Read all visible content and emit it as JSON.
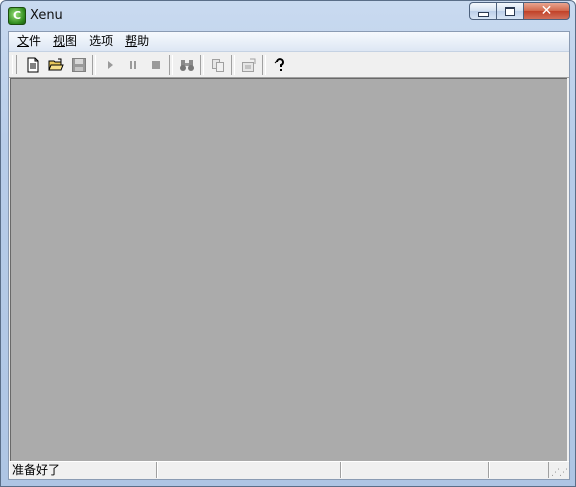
{
  "window": {
    "title": "Xenu",
    "icon": "xenu-frog-icon",
    "icon_letter": "C"
  },
  "menu": {
    "items": [
      {
        "label_ul": "文",
        "label_rest": "件"
      },
      {
        "label_ul": "视",
        "label_rest": "图"
      },
      {
        "label_ul": "",
        "label_rest": "选项"
      },
      {
        "label_ul": "帮",
        "label_rest": "助"
      }
    ]
  },
  "toolbar": {
    "buttons": [
      {
        "name": "new-icon",
        "enabled": true
      },
      {
        "name": "open-icon",
        "enabled": true
      },
      {
        "name": "save-icon",
        "enabled": false
      },
      {
        "name": "play-icon",
        "enabled": false
      },
      {
        "name": "pause-icon",
        "enabled": false
      },
      {
        "name": "stop-icon",
        "enabled": false
      },
      {
        "name": "binoculars-icon",
        "enabled": false
      },
      {
        "name": "copy-icon",
        "enabled": false
      },
      {
        "name": "properties-icon",
        "enabled": false
      },
      {
        "name": "help-icon",
        "enabled": true
      }
    ]
  },
  "status": {
    "text": "准备好了"
  },
  "colors": {
    "workspace": "#ababab",
    "titlebar": "#b7cce8",
    "close": "#c14128"
  }
}
